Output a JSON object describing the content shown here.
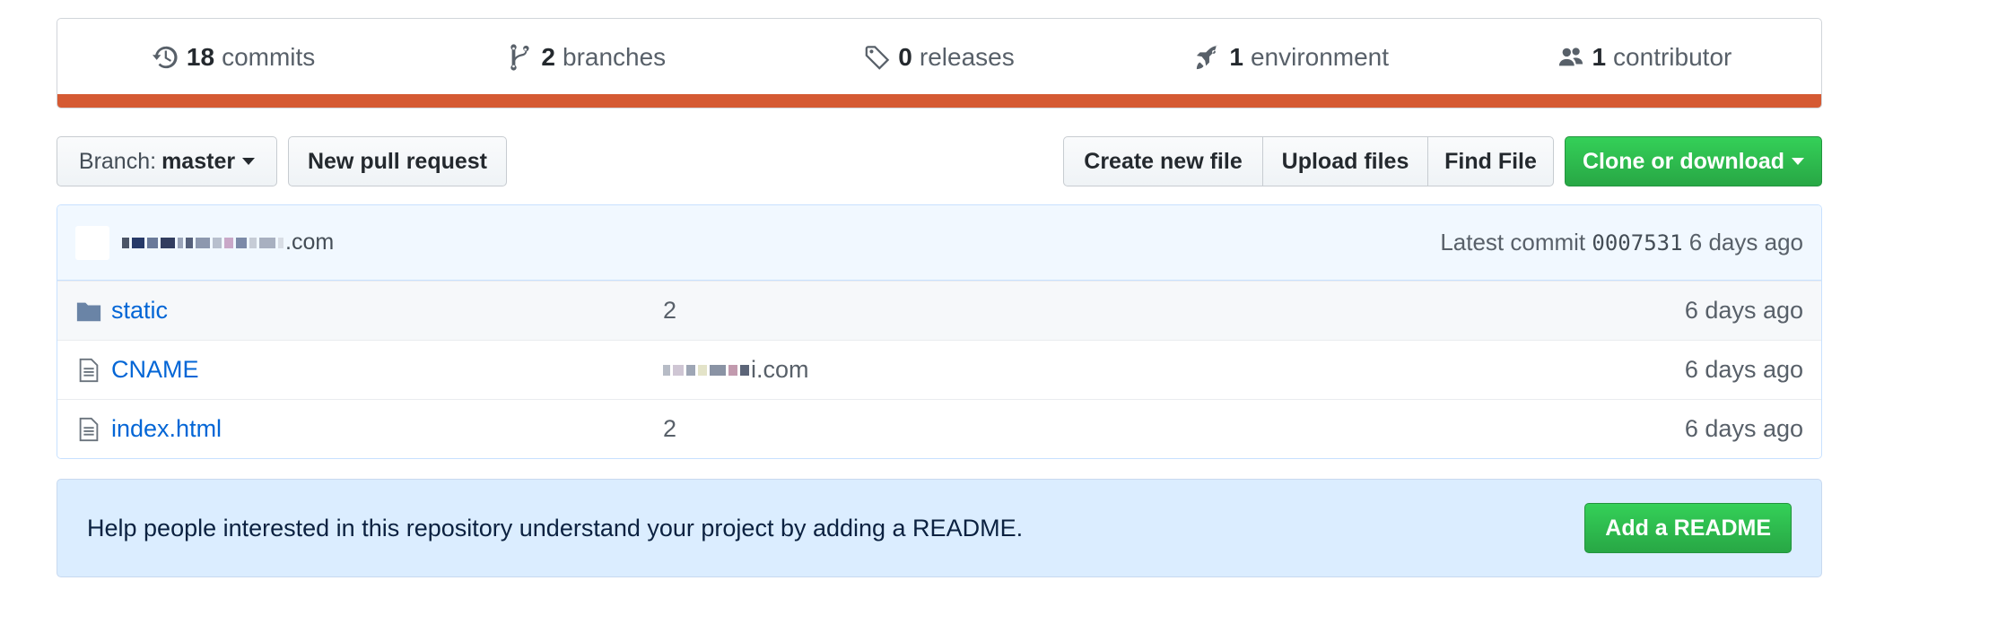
{
  "summary": {
    "commits": {
      "num": "18",
      "label": "commits",
      "icon": "history-icon"
    },
    "branches": {
      "num": "2",
      "label": "branches",
      "icon": "git-branch-icon"
    },
    "releases": {
      "num": "0",
      "label": "releases",
      "icon": "tag-icon"
    },
    "environment": {
      "num": "1",
      "label": "environment",
      "icon": "rocket-icon"
    },
    "contributors": {
      "num": "1",
      "label": "contributor",
      "icon": "people-icon"
    },
    "language_bar_color": "#d55a33"
  },
  "toolbar": {
    "branch_prefix": "Branch:",
    "branch_name": "master",
    "new_pull_request": "New pull request",
    "create_new_file": "Create new file",
    "upload_files": "Upload files",
    "find_file": "Find File",
    "clone_or_download": "Clone or download"
  },
  "commit": {
    "message_suffix": ".com",
    "latest_label": "Latest commit",
    "sha": "0007531",
    "age": "6 days ago"
  },
  "files": [
    {
      "type": "folder",
      "name": "static",
      "message": "2",
      "age": "6 days ago"
    },
    {
      "type": "file",
      "name": "CNAME",
      "message": "i.com",
      "age": "6 days ago"
    },
    {
      "type": "file",
      "name": "index.html",
      "message": "2",
      "age": "6 days ago"
    }
  ],
  "readme": {
    "text": "Help people interested in this repository understand your project by adding a README.",
    "button": "Add a README"
  },
  "colors": {
    "accent_green": "#28a745",
    "link_blue": "#0366d6",
    "readme_bg": "#dbedff"
  }
}
